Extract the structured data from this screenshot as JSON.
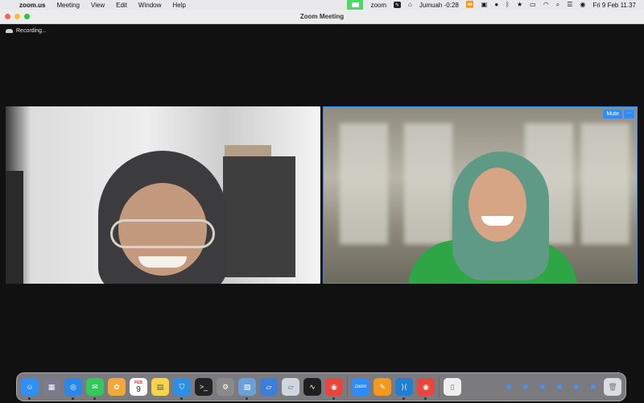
{
  "menubar": {
    "app_name": "zoom.us",
    "menus": [
      "Meeting",
      "View",
      "Edit",
      "Window",
      "Help"
    ],
    "status": {
      "zoom_label": "zoom",
      "prayer_label": "Jumuah -0:28",
      "datetime": "Fri 9 Feb  11.37"
    }
  },
  "window": {
    "title": "Zoom Meeting"
  },
  "meeting": {
    "recording_label": "Recording...",
    "participant_controls": {
      "mute_label": "Mute",
      "more_label": "···"
    }
  },
  "dock": {
    "calendar": {
      "month": "FEB",
      "day": "9"
    },
    "apps": [
      {
        "name": "Finder",
        "color": "#2f8ff7"
      },
      {
        "name": "Launchpad",
        "color": "#7b7b90"
      },
      {
        "name": "Safari",
        "color": "#2a88e8"
      },
      {
        "name": "Messages",
        "color": "#34c759"
      },
      {
        "name": "Photos",
        "color": "#f2a83b"
      },
      {
        "name": "Notes",
        "color": "#f6d54a"
      },
      {
        "name": "Keynote",
        "color": "#2b8fe6"
      },
      {
        "name": "Terminal",
        "color": "#222222"
      },
      {
        "name": "System Settings",
        "color": "#8a8a8a"
      },
      {
        "name": "Preview",
        "color": "#6aa0d8"
      },
      {
        "name": "Finder Window",
        "color": "#3d7fd8"
      },
      {
        "name": "Blank Window",
        "color": "#cfd6df"
      },
      {
        "name": "Activity Monitor",
        "color": "#1f1f1f"
      },
      {
        "name": "Chrome",
        "color": "#e8463c"
      },
      {
        "name": "Zoom",
        "color": "#2d8cff"
      },
      {
        "name": "Pages",
        "color": "#f39a1e"
      },
      {
        "name": "VS Code",
        "color": "#1f7fd1"
      },
      {
        "name": "Chrome Profile",
        "color": "#e8463c"
      },
      {
        "name": "Document",
        "color": "#eeeeee"
      },
      {
        "name": "Trash",
        "color": "#d8dde4"
      }
    ],
    "zoom_icon_label": "zoom"
  }
}
